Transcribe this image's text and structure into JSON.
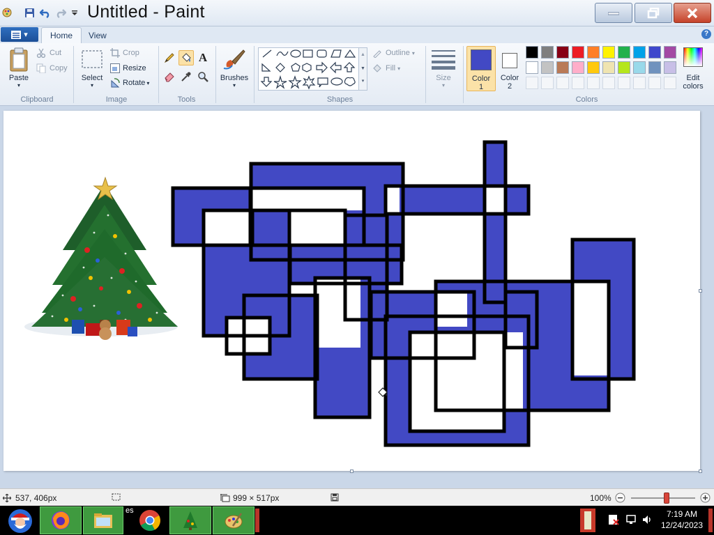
{
  "window": {
    "title": "Untitled - Paint"
  },
  "ribbon": {
    "file_menu_label": "▾",
    "tabs": [
      {
        "label": "Home",
        "active": true
      },
      {
        "label": "View",
        "active": false
      }
    ],
    "clipboard": {
      "paste": "Paste",
      "cut": "Cut",
      "copy": "Copy",
      "group": "Clipboard"
    },
    "image": {
      "select": "Select",
      "crop": "Crop",
      "resize": "Resize",
      "rotate": "Rotate",
      "group": "Image"
    },
    "tools": {
      "group": "Tools",
      "text_glyph": "A"
    },
    "brushes": {
      "label": "Brushes"
    },
    "shapes": {
      "group": "Shapes",
      "outline": "Outline",
      "fill": "Fill"
    },
    "size": {
      "label": "Size"
    },
    "colors": {
      "group": "Colors",
      "color1_label": "Color",
      "color1_num": "1",
      "color2_label": "Color",
      "color2_num": "2",
      "edit_label": "Edit",
      "edit_label2": "colors",
      "color1": "#4249c4",
      "color2": "#ffffff",
      "palette_row1": [
        "#000000",
        "#7f7f7f",
        "#880015",
        "#ed1c24",
        "#ff7f27",
        "#fff200",
        "#22b14c",
        "#00a2e8",
        "#3f48cc",
        "#a349a4"
      ],
      "palette_row2": [
        "#ffffff",
        "#c3c3c3",
        "#b97a57",
        "#ffaec9",
        "#ffc90e",
        "#efe4b0",
        "#b5e61d",
        "#99d9ea",
        "#7092be",
        "#c8bfe7"
      ]
    }
  },
  "canvas": {
    "fill_color": "#4249c4",
    "stroke_color": "#000000"
  },
  "status": {
    "cursor_pos": "537, 406px",
    "canvas_size": "999 × 517px",
    "zoom": "100%",
    "zoom_fraction": 0.55
  },
  "taskbar": {
    "clock_time": "7:19 AM",
    "clock_date": "12/24/2023",
    "partial_label": "es"
  }
}
